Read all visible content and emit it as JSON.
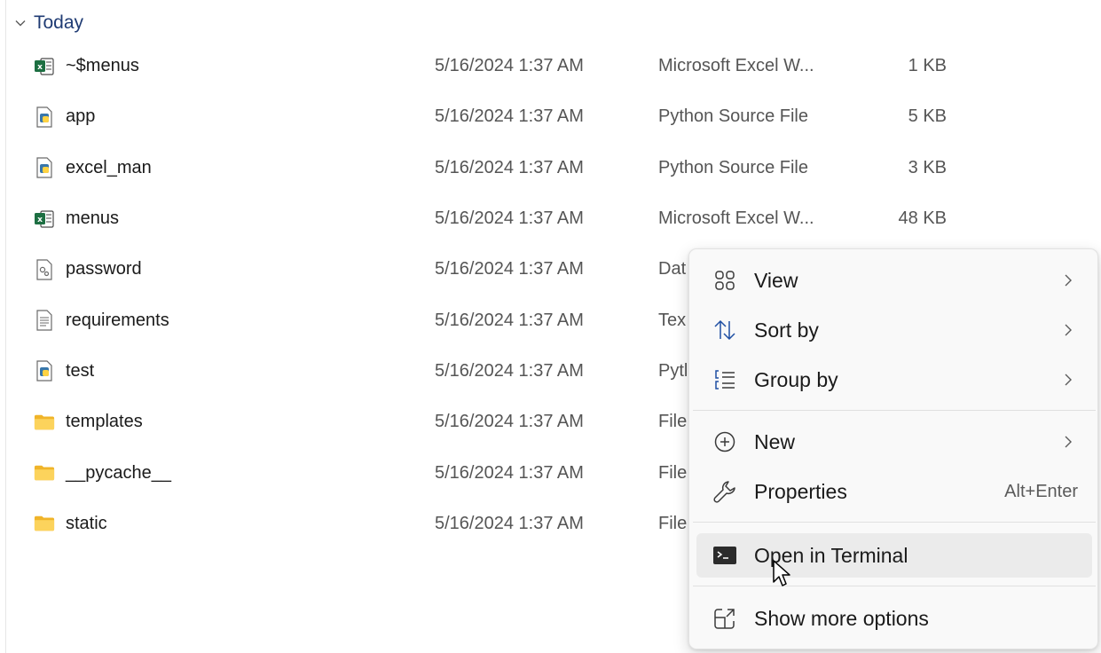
{
  "group": {
    "label": "Today"
  },
  "files": [
    {
      "icon": "excel-file-icon",
      "name": "~$menus",
      "date": "5/16/2024 1:37 AM",
      "type": "Microsoft Excel W...",
      "size": "1 KB"
    },
    {
      "icon": "python-file-icon",
      "name": "app",
      "date": "5/16/2024 1:37 AM",
      "type": "Python Source File",
      "size": "5 KB"
    },
    {
      "icon": "python-file-icon",
      "name": "excel_man",
      "date": "5/16/2024 1:37 AM",
      "type": "Python Source File",
      "size": "3 KB"
    },
    {
      "icon": "excel-file-icon",
      "name": "menus",
      "date": "5/16/2024 1:37 AM",
      "type": "Microsoft Excel W...",
      "size": "48 KB"
    },
    {
      "icon": "data-file-icon",
      "name": "password",
      "date": "5/16/2024 1:37 AM",
      "type": "Dat",
      "size": ""
    },
    {
      "icon": "text-file-icon",
      "name": "requirements",
      "date": "5/16/2024 1:37 AM",
      "type": "Tex",
      "size": ""
    },
    {
      "icon": "python-file-icon",
      "name": "test",
      "date": "5/16/2024 1:37 AM",
      "type": "Pytl",
      "size": ""
    },
    {
      "icon": "folder-icon",
      "name": "templates",
      "date": "5/16/2024 1:37 AM",
      "type": "File",
      "size": ""
    },
    {
      "icon": "folder-icon",
      "name": "__pycache__",
      "date": "5/16/2024 1:37 AM",
      "type": "File",
      "size": ""
    },
    {
      "icon": "folder-icon",
      "name": "static",
      "date": "5/16/2024 1:37 AM",
      "type": "File",
      "size": ""
    }
  ],
  "context_menu": {
    "view": {
      "label": "View",
      "icon": "view-grid-icon"
    },
    "sort_by": {
      "label": "Sort by",
      "icon": "sort-icon"
    },
    "group_by": {
      "label": "Group by",
      "icon": "group-icon"
    },
    "new": {
      "label": "New",
      "icon": "plus-circle-icon"
    },
    "properties": {
      "label": "Properties",
      "icon": "wrench-icon",
      "shortcut": "Alt+Enter"
    },
    "open_terminal": {
      "label": "Open in Terminal",
      "icon": "terminal-icon",
      "hovered": true
    },
    "show_more": {
      "label": "Show more options",
      "icon": "expand-icon"
    }
  },
  "colors": {
    "group_header": "#1f3b73",
    "excel_green": "#1d6f42",
    "python_blue": "#3776ab",
    "folder_yellow": "#f8c234",
    "menu_hover": "#ebebeb"
  }
}
